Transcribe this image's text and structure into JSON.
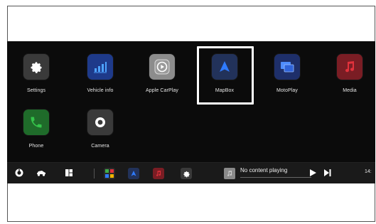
{
  "apps": [
    {
      "label": "Settings",
      "icon": "gear-icon",
      "color": "#3a3a3a"
    },
    {
      "label": "Vehicle info",
      "icon": "bar-chart-icon",
      "color": "#1e3a8a"
    },
    {
      "label": "Apple CarPlay",
      "icon": "carplay-icon",
      "color": "#8c8c8c"
    },
    {
      "label": "MapBox",
      "icon": "navigation-arrow-icon",
      "color": "#22325a"
    },
    {
      "label": "MotoPlay",
      "icon": "dual-screen-icon",
      "color": "#1e2f6a"
    },
    {
      "label": "Media",
      "icon": "music-note-icon",
      "color": "#7a1d24"
    },
    {
      "label": "Phone",
      "icon": "phone-icon",
      "color": "#1f6b2a"
    },
    {
      "label": "Camera",
      "icon": "camera-icon",
      "color": "#3a3a3a"
    }
  ],
  "dock": {
    "left_icons": [
      "power-icon",
      "car-icon",
      "dashboard-icon"
    ],
    "apps": [
      "widgets-icon",
      "navigation-arrow-icon",
      "music-note-icon",
      "gear-icon"
    ],
    "now_playing": "No content playing",
    "time": "14:"
  },
  "colors": {
    "background": "#0b0b0b",
    "dock": "#1a1a1a",
    "highlight": "#ffffff",
    "nav_blue": "#2f7bff",
    "media_red": "#e2323c",
    "phone_green": "#35c34a"
  }
}
